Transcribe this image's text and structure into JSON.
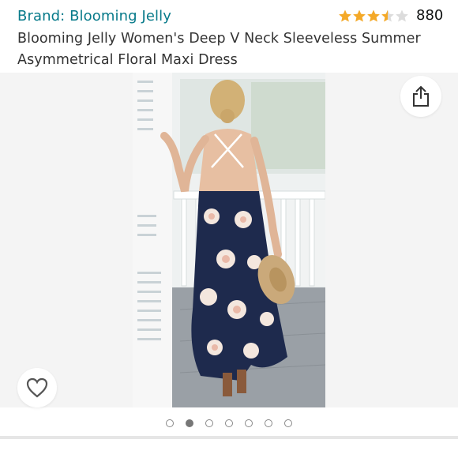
{
  "header": {
    "brand": "Brand: Blooming Jelly",
    "title": "Blooming Jelly Women's Deep V Neck Sleeveless Summer Asymmetrical Floral Maxi Dress",
    "rating": {
      "stars": 3.5,
      "count": "880"
    }
  },
  "gallery": {
    "image_count": 7,
    "active_index": 1,
    "share_icon": "share-icon",
    "wishlist_icon": "heart-icon"
  },
  "colors": {
    "brand_link": "#077a8a",
    "star": "#f4a928",
    "star_empty": "#dcdcdc",
    "dress_navy": "#1e2a4d"
  }
}
